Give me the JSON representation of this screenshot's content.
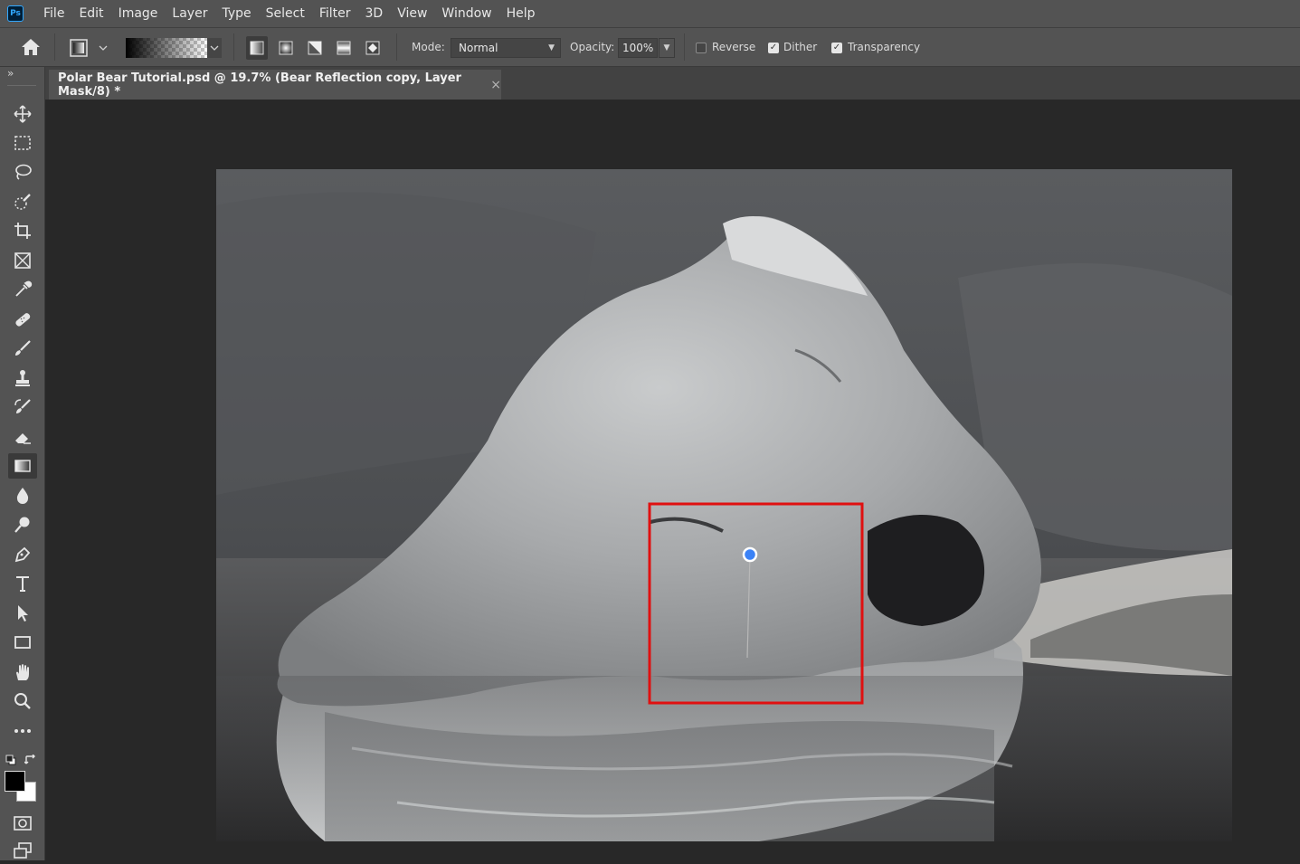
{
  "app": {
    "logo_text": "Ps",
    "menu": [
      "File",
      "Edit",
      "Image",
      "Layer",
      "Type",
      "Select",
      "Filter",
      "3D",
      "View",
      "Window",
      "Help"
    ]
  },
  "options": {
    "mode_label": "Mode:",
    "mode_value": "Normal",
    "opacity_label": "Opacity:",
    "opacity_value": "100%",
    "reverse_label": "Reverse",
    "reverse_checked": false,
    "dither_label": "Dither",
    "dither_checked": true,
    "transparency_label": "Transparency",
    "transparency_checked": true
  },
  "document": {
    "tab_title": "Polar Bear Tutorial.psd @ 19.7% (Bear Reflection copy, Layer Mask/8) *",
    "close_glyph": "×"
  },
  "toolbar": {
    "expand_glyph": "»",
    "tools": [
      "move-icon",
      "marquee-icon",
      "lasso-icon",
      "quick-selection-icon",
      "crop-icon",
      "frame-icon",
      "eyedropper-icon",
      "healing-brush-icon",
      "brush-icon",
      "stamp-icon",
      "history-brush-icon",
      "eraser-icon",
      "gradient-icon",
      "blur-icon",
      "dodge-icon",
      "pen-icon",
      "type-icon",
      "path-selection-icon",
      "rectangle-icon",
      "hand-icon",
      "zoom-icon",
      "more-tools-icon"
    ],
    "active_tool": "gradient-icon",
    "foreground_color": "#000000",
    "background_color": "#ffffff"
  },
  "colors": {
    "highlight_box": "#e01010",
    "gradient_handle": "#3b82f6"
  }
}
